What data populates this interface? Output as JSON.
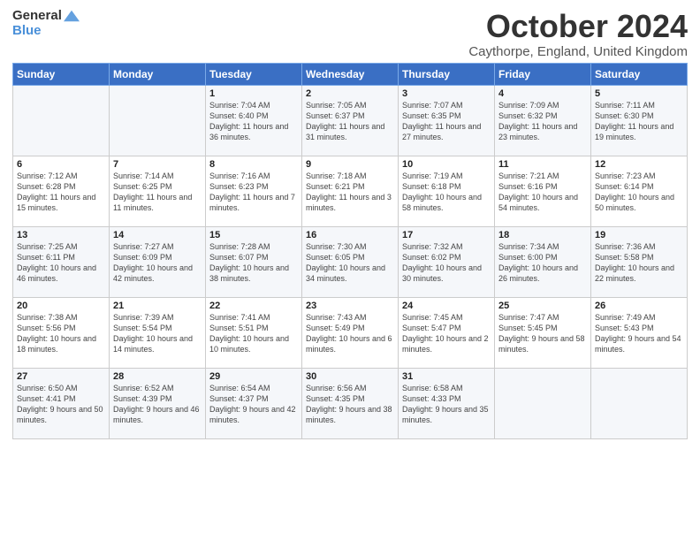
{
  "logo": {
    "general": "General",
    "blue": "Blue",
    "icon_color": "#4a90d9"
  },
  "title": {
    "month_year": "October 2024",
    "location": "Caythorpe, England, United Kingdom"
  },
  "days_of_week": [
    "Sunday",
    "Monday",
    "Tuesday",
    "Wednesday",
    "Thursday",
    "Friday",
    "Saturday"
  ],
  "weeks": [
    [
      {
        "day": "",
        "info": ""
      },
      {
        "day": "",
        "info": ""
      },
      {
        "day": "1",
        "info": "Sunrise: 7:04 AM\nSunset: 6:40 PM\nDaylight: 11 hours and 36 minutes."
      },
      {
        "day": "2",
        "info": "Sunrise: 7:05 AM\nSunset: 6:37 PM\nDaylight: 11 hours and 31 minutes."
      },
      {
        "day": "3",
        "info": "Sunrise: 7:07 AM\nSunset: 6:35 PM\nDaylight: 11 hours and 27 minutes."
      },
      {
        "day": "4",
        "info": "Sunrise: 7:09 AM\nSunset: 6:32 PM\nDaylight: 11 hours and 23 minutes."
      },
      {
        "day": "5",
        "info": "Sunrise: 7:11 AM\nSunset: 6:30 PM\nDaylight: 11 hours and 19 minutes."
      }
    ],
    [
      {
        "day": "6",
        "info": "Sunrise: 7:12 AM\nSunset: 6:28 PM\nDaylight: 11 hours and 15 minutes."
      },
      {
        "day": "7",
        "info": "Sunrise: 7:14 AM\nSunset: 6:25 PM\nDaylight: 11 hours and 11 minutes."
      },
      {
        "day": "8",
        "info": "Sunrise: 7:16 AM\nSunset: 6:23 PM\nDaylight: 11 hours and 7 minutes."
      },
      {
        "day": "9",
        "info": "Sunrise: 7:18 AM\nSunset: 6:21 PM\nDaylight: 11 hours and 3 minutes."
      },
      {
        "day": "10",
        "info": "Sunrise: 7:19 AM\nSunset: 6:18 PM\nDaylight: 10 hours and 58 minutes."
      },
      {
        "day": "11",
        "info": "Sunrise: 7:21 AM\nSunset: 6:16 PM\nDaylight: 10 hours and 54 minutes."
      },
      {
        "day": "12",
        "info": "Sunrise: 7:23 AM\nSunset: 6:14 PM\nDaylight: 10 hours and 50 minutes."
      }
    ],
    [
      {
        "day": "13",
        "info": "Sunrise: 7:25 AM\nSunset: 6:11 PM\nDaylight: 10 hours and 46 minutes."
      },
      {
        "day": "14",
        "info": "Sunrise: 7:27 AM\nSunset: 6:09 PM\nDaylight: 10 hours and 42 minutes."
      },
      {
        "day": "15",
        "info": "Sunrise: 7:28 AM\nSunset: 6:07 PM\nDaylight: 10 hours and 38 minutes."
      },
      {
        "day": "16",
        "info": "Sunrise: 7:30 AM\nSunset: 6:05 PM\nDaylight: 10 hours and 34 minutes."
      },
      {
        "day": "17",
        "info": "Sunrise: 7:32 AM\nSunset: 6:02 PM\nDaylight: 10 hours and 30 minutes."
      },
      {
        "day": "18",
        "info": "Sunrise: 7:34 AM\nSunset: 6:00 PM\nDaylight: 10 hours and 26 minutes."
      },
      {
        "day": "19",
        "info": "Sunrise: 7:36 AM\nSunset: 5:58 PM\nDaylight: 10 hours and 22 minutes."
      }
    ],
    [
      {
        "day": "20",
        "info": "Sunrise: 7:38 AM\nSunset: 5:56 PM\nDaylight: 10 hours and 18 minutes."
      },
      {
        "day": "21",
        "info": "Sunrise: 7:39 AM\nSunset: 5:54 PM\nDaylight: 10 hours and 14 minutes."
      },
      {
        "day": "22",
        "info": "Sunrise: 7:41 AM\nSunset: 5:51 PM\nDaylight: 10 hours and 10 minutes."
      },
      {
        "day": "23",
        "info": "Sunrise: 7:43 AM\nSunset: 5:49 PM\nDaylight: 10 hours and 6 minutes."
      },
      {
        "day": "24",
        "info": "Sunrise: 7:45 AM\nSunset: 5:47 PM\nDaylight: 10 hours and 2 minutes."
      },
      {
        "day": "25",
        "info": "Sunrise: 7:47 AM\nSunset: 5:45 PM\nDaylight: 9 hours and 58 minutes."
      },
      {
        "day": "26",
        "info": "Sunrise: 7:49 AM\nSunset: 5:43 PM\nDaylight: 9 hours and 54 minutes."
      }
    ],
    [
      {
        "day": "27",
        "info": "Sunrise: 6:50 AM\nSunset: 4:41 PM\nDaylight: 9 hours and 50 minutes."
      },
      {
        "day": "28",
        "info": "Sunrise: 6:52 AM\nSunset: 4:39 PM\nDaylight: 9 hours and 46 minutes."
      },
      {
        "day": "29",
        "info": "Sunrise: 6:54 AM\nSunset: 4:37 PM\nDaylight: 9 hours and 42 minutes."
      },
      {
        "day": "30",
        "info": "Sunrise: 6:56 AM\nSunset: 4:35 PM\nDaylight: 9 hours and 38 minutes."
      },
      {
        "day": "31",
        "info": "Sunrise: 6:58 AM\nSunset: 4:33 PM\nDaylight: 9 hours and 35 minutes."
      },
      {
        "day": "",
        "info": ""
      },
      {
        "day": "",
        "info": ""
      }
    ]
  ]
}
